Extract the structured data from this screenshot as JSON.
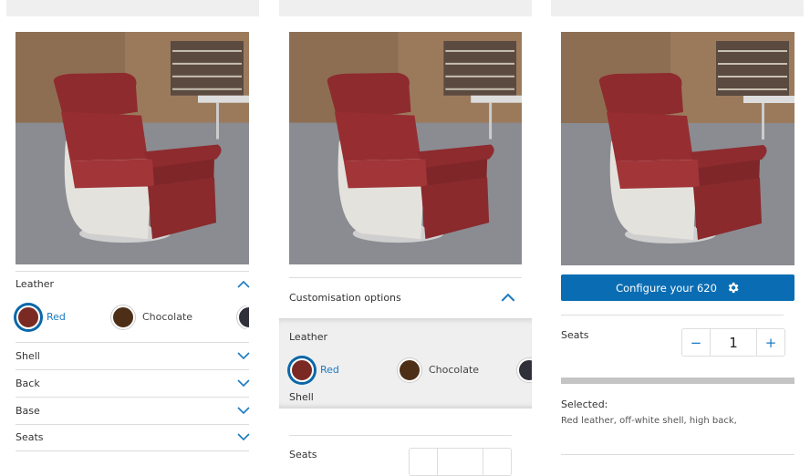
{
  "accent": "#0a6db3",
  "product_image_alt": "Red leather 620 armchair",
  "panel1": {
    "sections": [
      {
        "label": "Leather",
        "expanded": true
      },
      {
        "label": "Shell"
      },
      {
        "label": "Back"
      },
      {
        "label": "Base"
      },
      {
        "label": "Seats"
      }
    ],
    "swatches": [
      {
        "label": "Red",
        "color": "#7a2a22",
        "selected": true
      },
      {
        "label": "Chocolate",
        "color": "#4d2f18"
      },
      {
        "label": "",
        "color": "#30303a"
      }
    ]
  },
  "panel2": {
    "header": "Customisation options",
    "leather_label": "Leather",
    "shell_label": "Shell",
    "swatches": [
      {
        "label": "Red",
        "color": "#7a2a22",
        "selected": true
      },
      {
        "label": "Chocolate",
        "color": "#4d2f18"
      },
      {
        "label": "",
        "color": "#30303a"
      }
    ],
    "seats_label": "Seats"
  },
  "panel3": {
    "configure_button": "Configure your 620",
    "seats_label": "Seats",
    "seats_value": "1",
    "minus": "−",
    "plus": "+",
    "selected_label": "Selected:",
    "selected_text": "Red leather, off-white shell, high back,"
  }
}
